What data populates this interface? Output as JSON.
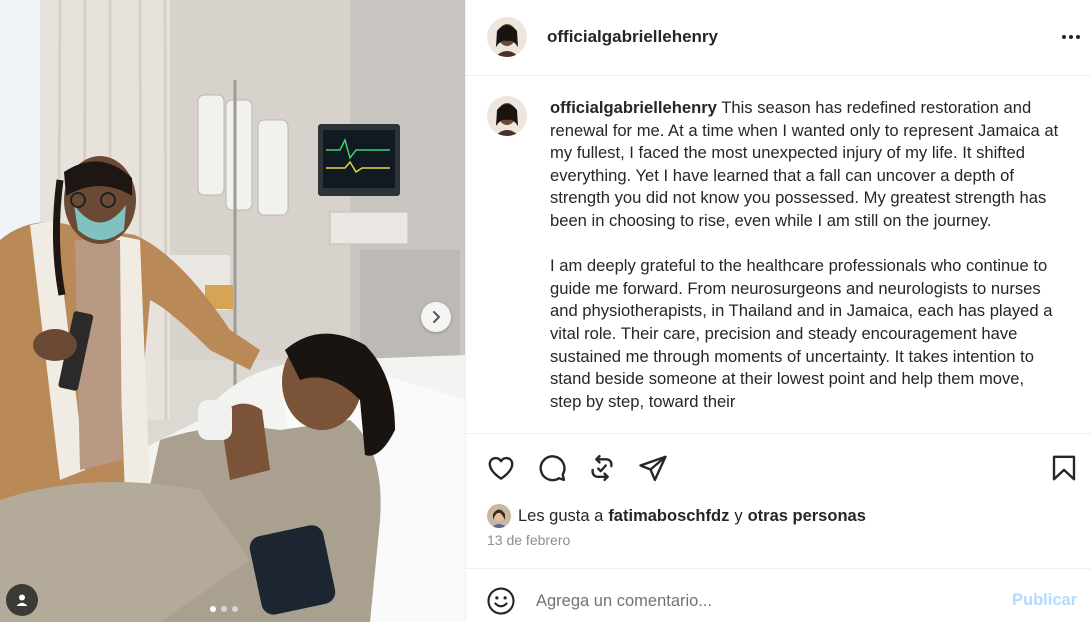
{
  "post": {
    "username": "officialgabriellehenry",
    "more_icon": "more-horizontal-icon"
  },
  "media": {
    "description_icon": "photo",
    "carousel": {
      "count": 3,
      "active_index": 0
    },
    "next_icon": "chevron-right-icon",
    "tag_icon": "person-tag-icon"
  },
  "caption": {
    "username": "officialgabriellehenry",
    "paragraph1": "This season has redefined restoration and renewal for me. At a time when I wanted only to represent Jamaica at my fullest, I faced the most unexpected injury of my life. It shifted everything. Yet I have learned that a fall can uncover a depth of strength you did not know you possessed. My greatest strength has been in choosing to rise, even while I am still on the journey.",
    "paragraph2": "I am deeply grateful to the healthcare professionals who continue to guide me forward. From neurosurgeons and neurologists to nurses and physiotherapists, in Thailand and in Jamaica, each has played a vital role. Their care, precision and steady encouragement have sustained me through moments of uncertainty. It takes intention to stand beside someone at their lowest point and help them move, step by step, toward their"
  },
  "actions": {
    "like_icon": "heart-icon",
    "comment_icon": "comment-icon",
    "repost_icon": "repost-icon",
    "share_icon": "share-icon",
    "save_icon": "bookmark-icon"
  },
  "likes": {
    "prefix": "Les gusta a",
    "user": "fatimaboschfdz",
    "connector": "y",
    "others": "otras personas"
  },
  "date": "13 de febrero",
  "comment": {
    "placeholder": "Agrega un comentario...",
    "publish_label": "Publicar",
    "emoji_icon": "smiley-icon"
  },
  "colors": {
    "text": "#262626",
    "secondary_text": "#8e8e8e",
    "publish_disabled": "#b3dbff",
    "divider": "#efefef"
  }
}
